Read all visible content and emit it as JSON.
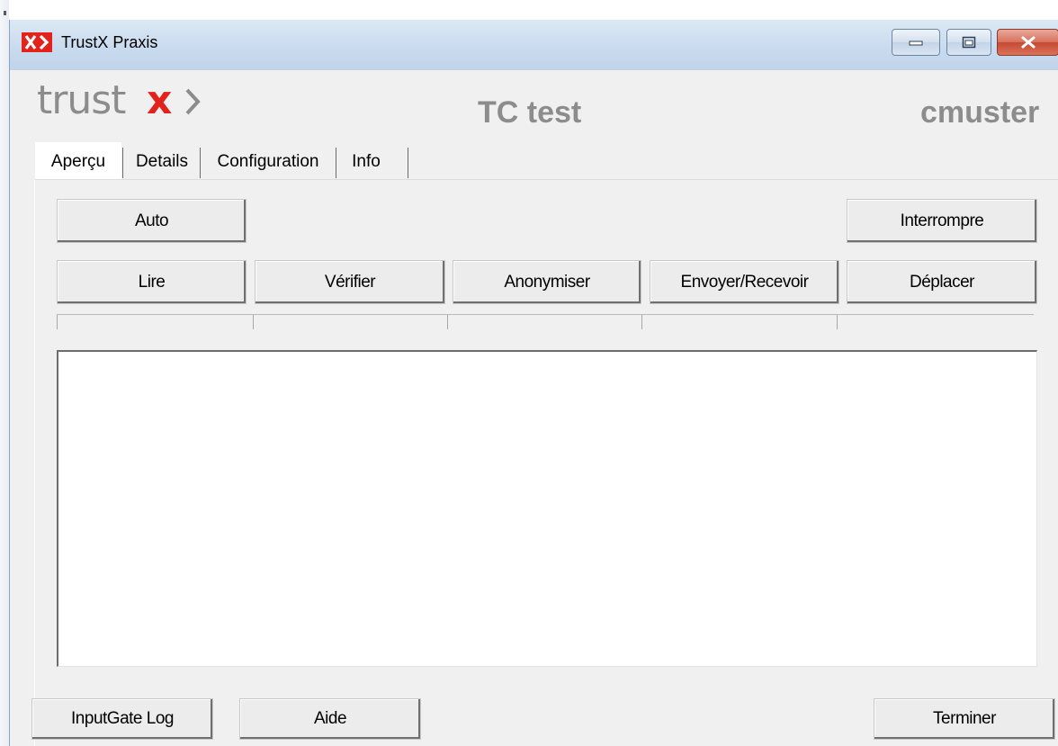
{
  "window": {
    "title": "TrustX Praxis",
    "colors": {
      "brand_red": "#e3231b",
      "logo_gray": "#8c8c8c"
    },
    "controls": {
      "minimize_icon": "minimize-icon",
      "maximize_icon": "maximize-icon",
      "close_icon": "close-icon"
    }
  },
  "header": {
    "logo_text": "trust",
    "logo_x": "x",
    "center_title": "TC test",
    "user": "cmuster"
  },
  "tabs": [
    {
      "label": "Aperçu",
      "active": true
    },
    {
      "label": "Details",
      "active": false
    },
    {
      "label": "Configuration",
      "active": false
    },
    {
      "label": "Info",
      "active": false
    }
  ],
  "actions": {
    "auto": "Auto",
    "interrupt": "Interrompre",
    "read": "Lire",
    "verify": "Vérifier",
    "anonymize": "Anonymiser",
    "send_receive": "Envoyer/Recevoir",
    "move": "Déplacer"
  },
  "footer": {
    "log": "InputGate Log",
    "help": "Aide",
    "finish": "Terminer"
  }
}
